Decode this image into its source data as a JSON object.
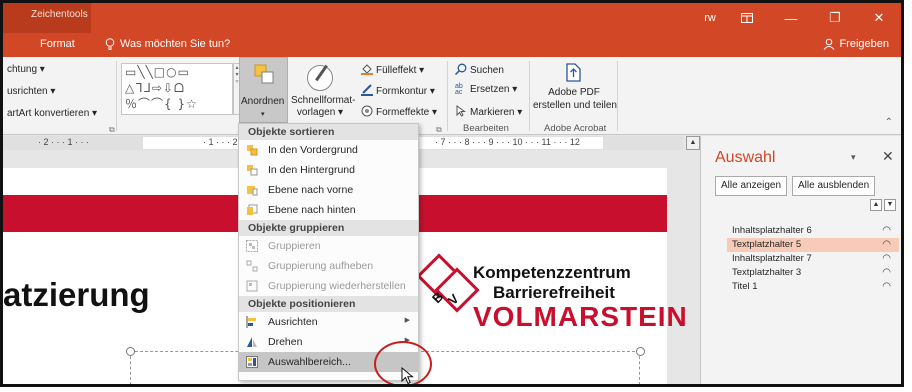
{
  "titlebar": {
    "contextual_label": "Zeichentools",
    "user": "rw",
    "ribbon_display_icon": "ribbon-display-icon",
    "minimize": "—",
    "restore": "❐",
    "close": "✕"
  },
  "tabs": {
    "format": "Format",
    "tellme": "Was möchten Sie tun?",
    "share": "Freigeben"
  },
  "ribbon": {
    "row1": "chtung ▾",
    "row2": "usrichten ▾",
    "row3": "artArt konvertieren ▾",
    "shapes_row1": "▭╲╲□○▭",
    "shapes_row2": "△ᒣᒧ⇨⇩ᗝ",
    "shapes_row3": "％⌒⌒{ }☆",
    "anordnen": "Anordnen",
    "schnell1": "Schnellformat-",
    "schnell2": "vorlagen ▾",
    "fuelleffekt": "Fülleffekt ▾",
    "formkontur": "Formkontur ▾",
    "formeffekte": "Formeffekte ▾",
    "suchen": "Suchen",
    "ersetzen": "Ersetzen ▾",
    "markieren": "Markieren ▾",
    "bearbeiten": "Bearbeiten",
    "pdf1": "Adobe PDF",
    "pdf2": "erstellen und teilen",
    "adobe_acrobat": "Adobe Acrobat"
  },
  "ruler": {
    "left": "· 2 · · · 1 · · ·",
    "mid": "· 1 · · · 2",
    "right": "· 7 · · · 8 · · · 9 · · · 10 · · · 11 · · · 12"
  },
  "slide": {
    "title": "atzierung",
    "logo_b": "B",
    "logo_v": "V",
    "logo_line1": "Kompetenzzentrum",
    "logo_line2": "Barrierefreiheit",
    "logo_line3": "VOLMARSTEIN"
  },
  "menu": {
    "head_sort": "Objekte sortieren",
    "items_sort": [
      "In den Vordergrund",
      "In den Hintergrund",
      "Ebene nach vorne",
      "Ebene nach hinten"
    ],
    "head_group": "Objekte gruppieren",
    "items_group": [
      "Gruppieren",
      "Gruppierung aufheben",
      "Gruppierung wiederherstellen"
    ],
    "head_pos": "Objekte positionieren",
    "items_pos": [
      "Ausrichten",
      "Drehen",
      "Auswahlbereich..."
    ]
  },
  "pane": {
    "title": "Auswahl",
    "show_all": "Alle anzeigen",
    "hide_all": "Alle ausblenden",
    "items": [
      "Inhaltsplatzhalter 6",
      "Textplatzhalter 5",
      "Inhaltsplatzhalter 7",
      "Textplatzhalter 3",
      "Titel 1"
    ],
    "selected_index": 1
  },
  "colors": {
    "accent": "#d24726",
    "brand_red": "#c8102e",
    "selected_row": "#f8cbb8"
  }
}
